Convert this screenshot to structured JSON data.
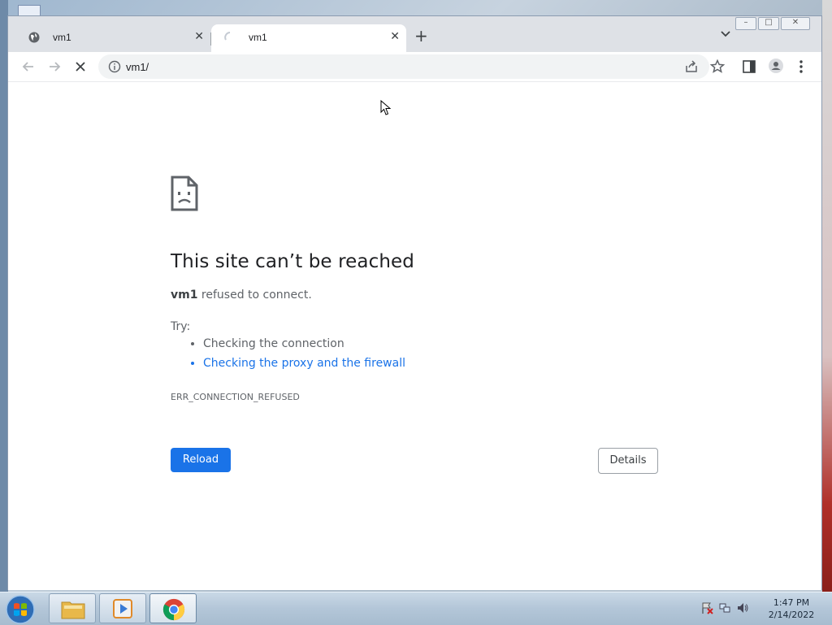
{
  "browser": {
    "tabs": [
      {
        "label": "vm1",
        "icon": "globe-icon",
        "active": false
      },
      {
        "label": "vm1",
        "icon": "loading-spinner-icon",
        "active": true
      }
    ],
    "address": {
      "url": "vm1/"
    }
  },
  "error_page": {
    "title": "This site can’t be reached",
    "host": "vm1",
    "message": " refused to connect.",
    "try_label": "Try:",
    "suggestions": [
      {
        "text": "Checking the connection",
        "link": false
      },
      {
        "text": "Checking the proxy and the firewall",
        "link": true
      }
    ],
    "error_code": "ERR_CONNECTION_REFUSED",
    "reload_label": "Reload",
    "details_label": "Details"
  },
  "taskbar": {
    "clock_time": "1:47 PM",
    "clock_date": "2/14/2022"
  },
  "colors": {
    "accent": "#1a73e8",
    "tab_bg": "#dee1e6",
    "toolbar_bg": "#ffffff"
  }
}
